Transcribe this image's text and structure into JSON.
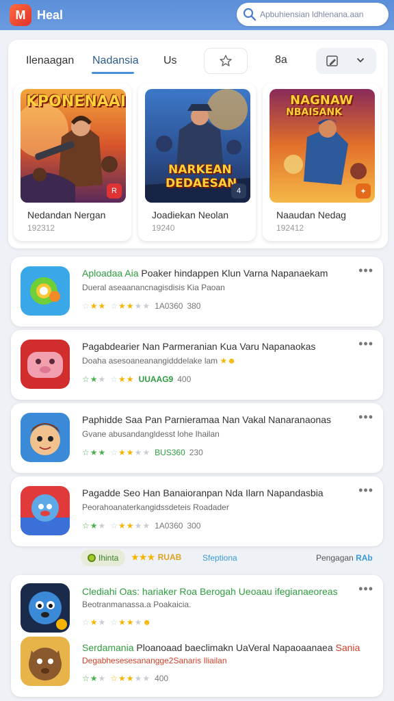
{
  "header": {
    "app_title": "Heal",
    "logo_letter": "M",
    "search_placeholder": "Apbuhiensian ldhlenana.aan"
  },
  "tabs": [
    {
      "label": "Ilenaagan"
    },
    {
      "label": "Nadansia"
    },
    {
      "label": "Us"
    }
  ],
  "tab_extra_label": "8a",
  "featured": [
    {
      "art_title": "KPONENAAI",
      "title": "Nedandan Nergan",
      "number": "192312"
    },
    {
      "art_title_1": "NARKEAN",
      "art_title_2": "DEDAESAN",
      "title": "Joadiekan Neolan",
      "number": "19240"
    },
    {
      "art_title_1": "NAGNAW",
      "art_title_2": "NBAISANK",
      "title": "Naaudan Nedag",
      "number": "192412"
    }
  ],
  "apps": [
    {
      "title_hl": "Aploadaa Aia",
      "title_rest": " Poaker hindappen Klun Varna Napanaekam",
      "subtitle": "Dueral aseaanancnagisdisis Kia Paoan",
      "meta": "1A0360",
      "count": "380"
    },
    {
      "title_hl": "",
      "title_rest": "Pagabdearier Nan Parmeranian Kua Varu Napanaokas",
      "subtitle": "Doaha asesoaneanangidddelake lam",
      "meta": "UUAAG9",
      "count": "400"
    },
    {
      "title_hl": "",
      "title_rest": "Paphidde Saa Pan Parnieramaa Nan Vakal Nanaranaonas",
      "subtitle": "Gvane abusandangldesst lohe Ihailan",
      "meta": "BUS360",
      "count": "230"
    },
    {
      "title_hl": "",
      "title_rest": "Pagadde Seo Han Banaioranpan Nda Ilarn Napandasbia",
      "subtitle": "Peorahoanaterkangidssdeteis Roadader",
      "meta": "1A0360",
      "count": "300"
    }
  ],
  "filters": {
    "chip_label": "Ihinta",
    "rating_label": "RUAB",
    "sort_label": "Sfeptiona",
    "right_label": "Pengagan",
    "right_hl": "RAb"
  },
  "bottom_items": [
    {
      "title": "Clediahi Oas: hariaker Roa Berogah Ueoaau ifegianaeoreas",
      "subtitle": "Beotranmanassa.a Poakaicia."
    },
    {
      "title": "Serdamania",
      "title_rest": " Ploanoaad baeclimakn UaVeral Napaoaanaea",
      "title_end": " Sania",
      "subtitle": "Degabhesesesanangge2Sanaris Iliailan",
      "count": "400"
    }
  ],
  "colors": {
    "accent": "#4a90d9",
    "green": "#2e9d3e",
    "star": "#f5b400",
    "header": "#5b8fd9"
  }
}
